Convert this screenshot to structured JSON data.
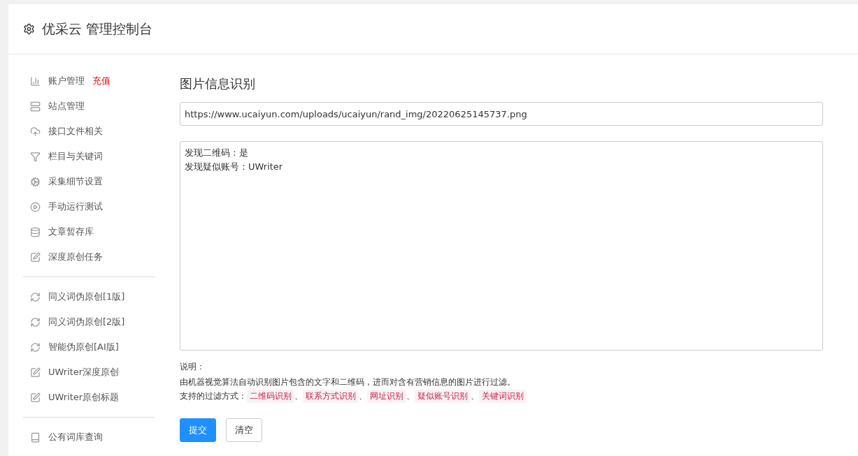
{
  "header": {
    "title": "优采云 管理控制台"
  },
  "sidebar": {
    "sections": [
      {
        "items": [
          {
            "label": "账户管理",
            "badge": "充值"
          },
          {
            "label": "站点管理"
          },
          {
            "label": "接口文件相关"
          },
          {
            "label": "栏目与关键词"
          },
          {
            "label": "采集细节设置"
          },
          {
            "label": "手动运行测试"
          },
          {
            "label": "文章暂存库"
          },
          {
            "label": "深度原创任务"
          }
        ]
      },
      {
        "items": [
          {
            "label": "同义词伪原创[1版]"
          },
          {
            "label": "同义词伪原创[2版]"
          },
          {
            "label": "智能伪原创[AI版]"
          },
          {
            "label": "UWriter深度原创"
          },
          {
            "label": "UWriter原创标题"
          }
        ]
      },
      {
        "items": [
          {
            "label": "公有词库查询"
          }
        ]
      }
    ]
  },
  "main": {
    "title": "图片信息识别",
    "url_field": {
      "value": "https://www.ucaiyun.com/uploads/ucaiyun/rand_img/20220625145737.png"
    },
    "result_box": {
      "lines": [
        "发现二维码：是",
        "发现疑似账号：UWriter"
      ]
    },
    "notes": {
      "heading": "说明：",
      "description": "由机器视觉算法自动识别图片包含的文字和二维码，进而对含有营销信息的图片进行过滤。",
      "methods_label": "支持的过滤方式：",
      "separator": "、",
      "methods": [
        "二维码识别",
        "联系方式识别",
        "网址识别",
        "疑似账号识别",
        "关键词识别"
      ]
    },
    "buttons": [
      {
        "label": "提交",
        "kind": "primary"
      },
      {
        "label": "清空",
        "kind": "default"
      }
    ]
  }
}
